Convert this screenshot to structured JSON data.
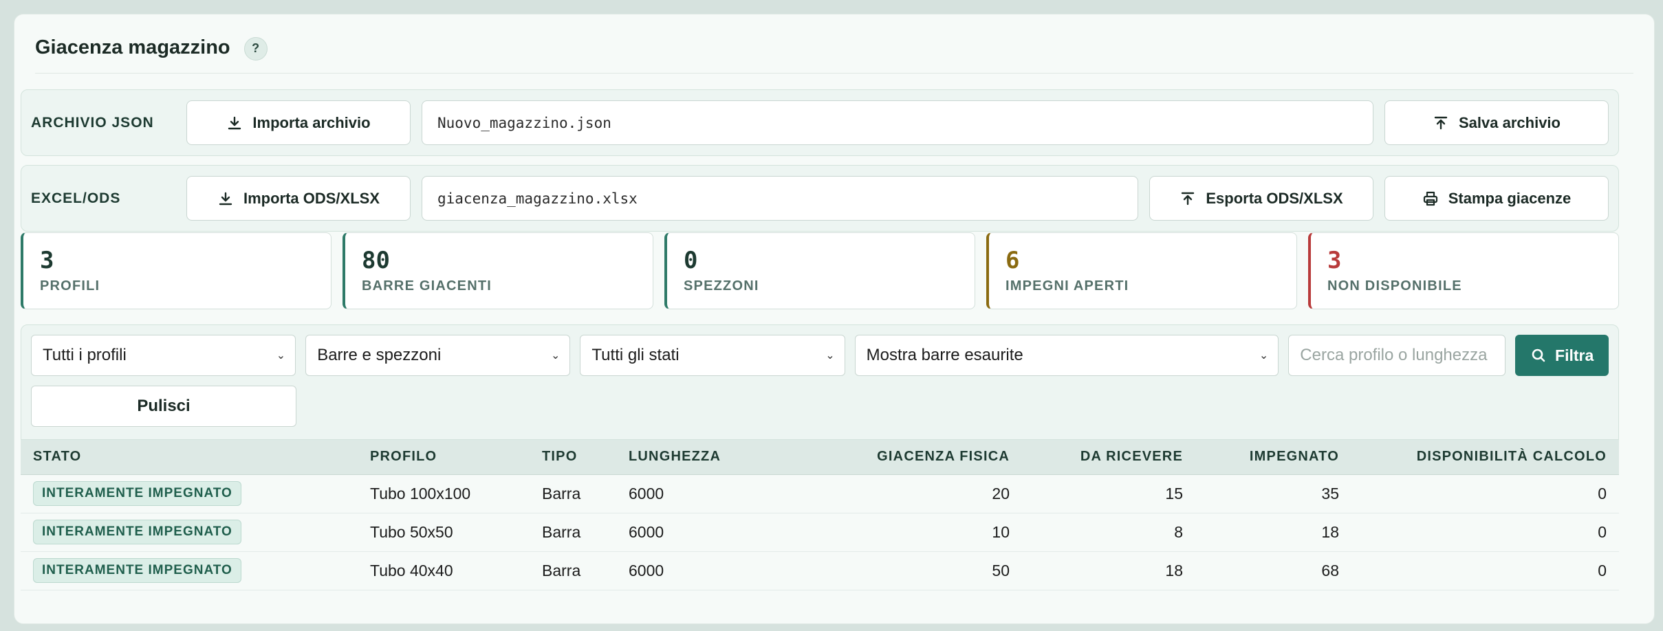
{
  "page": {
    "title": "Giacenza magazzino",
    "help": "?"
  },
  "json_bar": {
    "label": "ARCHIVIO JSON",
    "import_label": "Importa archivio",
    "filename": "Nuovo_magazzino.json",
    "save_label": "Salva archivio"
  },
  "excel_bar": {
    "label": "EXCEL/ODS",
    "import_label": "Importa ODS/XLSX",
    "filename": "giacenza_magazzino.xlsx",
    "export_label": "Esporta ODS/XLSX",
    "print_label": "Stampa giacenze"
  },
  "stats": [
    {
      "value": "3",
      "label": "PROFILI"
    },
    {
      "value": "80",
      "label": "BARRE GIACENTI"
    },
    {
      "value": "0",
      "label": "SPEZZONI"
    },
    {
      "value": "6",
      "label": "IMPEGNI APERTI"
    },
    {
      "value": "3",
      "label": "NON DISPONIBILE"
    }
  ],
  "filters": {
    "profile": "Tutti i profili",
    "type": "Barre e spezzoni",
    "state": "Tutti gli stati",
    "exhausted": "Mostra barre esaurite",
    "search_placeholder": "Cerca profilo o lunghezza",
    "filter_label": "Filtra",
    "clear_label": "Pulisci"
  },
  "table": {
    "headers": [
      "STATO",
      "PROFILO",
      "TIPO",
      "LUNGHEZZA",
      "GIACENZA FISICA",
      "DA RICEVERE",
      "IMPEGNATO",
      "DISPONIBILITÀ CALCOLO"
    ],
    "rows": [
      {
        "stato": "INTERAMENTE IMPEGNATO",
        "profilo": "Tubo 100x100",
        "tipo": "Barra",
        "lunghezza": "6000",
        "giacenza": "20",
        "ricevere": "15",
        "impegnato": "35",
        "disponibilita": "0"
      },
      {
        "stato": "INTERAMENTE IMPEGNATO",
        "profilo": "Tubo 50x50",
        "tipo": "Barra",
        "lunghezza": "6000",
        "giacenza": "10",
        "ricevere": "8",
        "impegnato": "18",
        "disponibilita": "0"
      },
      {
        "stato": "INTERAMENTE IMPEGNATO",
        "profilo": "Tubo 40x40",
        "tipo": "Barra",
        "lunghezza": "6000",
        "giacenza": "50",
        "ricevere": "18",
        "impegnato": "68",
        "disponibilita": "0"
      }
    ]
  },
  "colors": {
    "accent": "#24776a",
    "warning": "#8a6a10",
    "danger": "#b83a3a"
  }
}
